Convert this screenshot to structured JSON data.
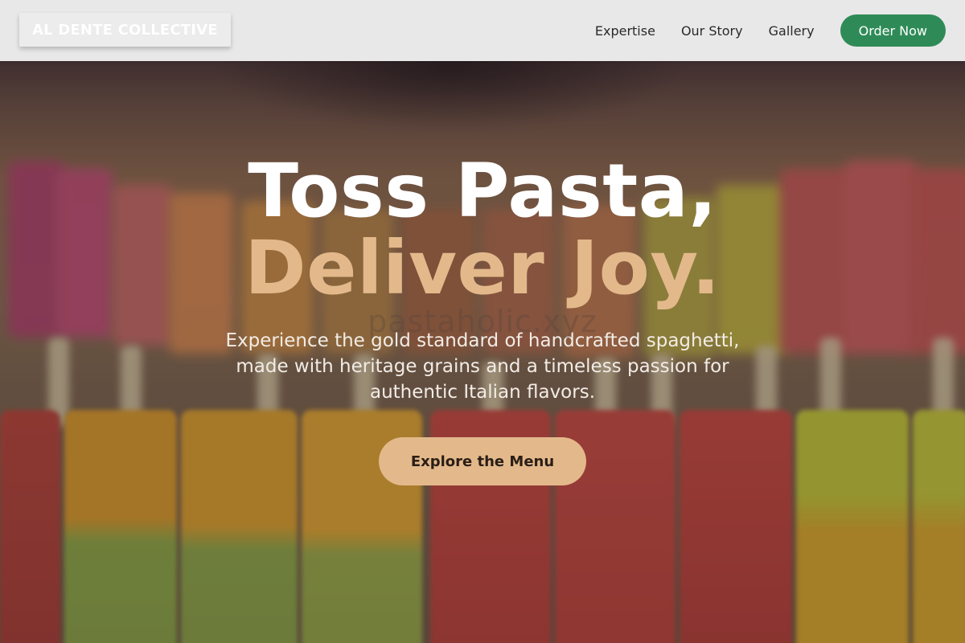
{
  "brand": {
    "logo_text": "AL DENTE COLLECTIVE"
  },
  "nav": {
    "links": [
      "Expertise",
      "Our Story",
      "Gallery"
    ],
    "order_label": "Order Now"
  },
  "hero": {
    "headline_line1": "Toss Pasta,",
    "headline_line2": "Deliver Joy.",
    "watermark": "pastaholic.xyz",
    "subtitle": "Experience the gold standard of handcrafted spaghetti, made with heritage grains and a timeless passion for authentic Italian flavors.",
    "cta_label": "Explore the Menu",
    "background": "popsicle-display-photo"
  },
  "colors": {
    "accent_green": "#2e8b57",
    "accent_gold": "#e3b98b",
    "header_bg": "#f0f0f0"
  }
}
